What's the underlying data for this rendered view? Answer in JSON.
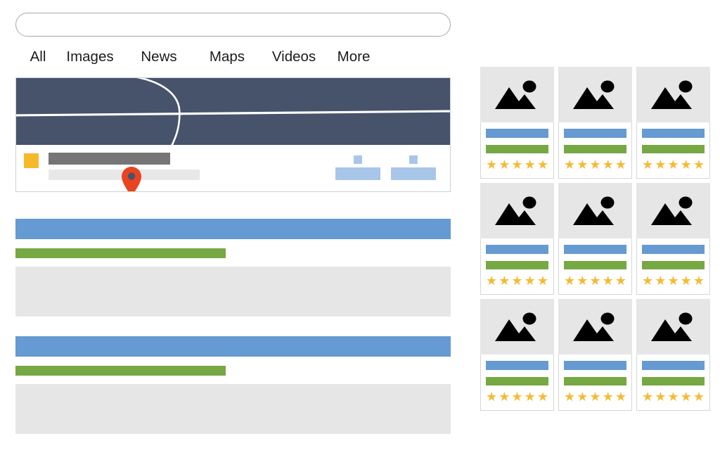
{
  "search": {
    "value": "",
    "placeholder": ""
  },
  "nav": {
    "tabs": [
      {
        "label": "All"
      },
      {
        "label": "Images"
      },
      {
        "label": "News"
      },
      {
        "label": "Maps"
      },
      {
        "label": "Videos"
      },
      {
        "label": "More"
      }
    ]
  },
  "map_card": {
    "marker_icon": "map-pin-icon",
    "road_color": "#ffffff",
    "map_background": "#47536b",
    "place": {
      "thumbnail_color": "#f5b92b",
      "title_placeholder": "",
      "subtitle_placeholder": ""
    },
    "actions": [
      {
        "icon": "directions-icon",
        "label": ""
      },
      {
        "icon": "share-icon",
        "label": ""
      }
    ]
  },
  "results": [
    {
      "title": "",
      "url": "",
      "snippet": ""
    },
    {
      "title": "",
      "url": "",
      "snippet": ""
    }
  ],
  "products": [
    {
      "image_icon": "image-placeholder-icon",
      "title": "",
      "price": "",
      "rating": 5
    },
    {
      "image_icon": "image-placeholder-icon",
      "title": "",
      "price": "",
      "rating": 5
    },
    {
      "image_icon": "image-placeholder-icon",
      "title": "",
      "price": "",
      "rating": 5
    },
    {
      "image_icon": "image-placeholder-icon",
      "title": "",
      "price": "",
      "rating": 5
    },
    {
      "image_icon": "image-placeholder-icon",
      "title": "",
      "price": "",
      "rating": 5
    },
    {
      "image_icon": "image-placeholder-icon",
      "title": "",
      "price": "",
      "rating": 5
    },
    {
      "image_icon": "image-placeholder-icon",
      "title": "",
      "price": "",
      "rating": 5
    },
    {
      "image_icon": "image-placeholder-icon",
      "title": "",
      "price": "",
      "rating": 5
    },
    {
      "image_icon": "image-placeholder-icon",
      "title": "",
      "price": "",
      "rating": 5
    }
  ],
  "colors": {
    "accent_blue": "#659ad2",
    "accent_green": "#76a843",
    "star_gold": "#f5bb33",
    "marker_red": "#e8441f",
    "map_navy": "#47536b",
    "placeholder_gray": "#e6e6e6"
  },
  "star_glyph": "★"
}
